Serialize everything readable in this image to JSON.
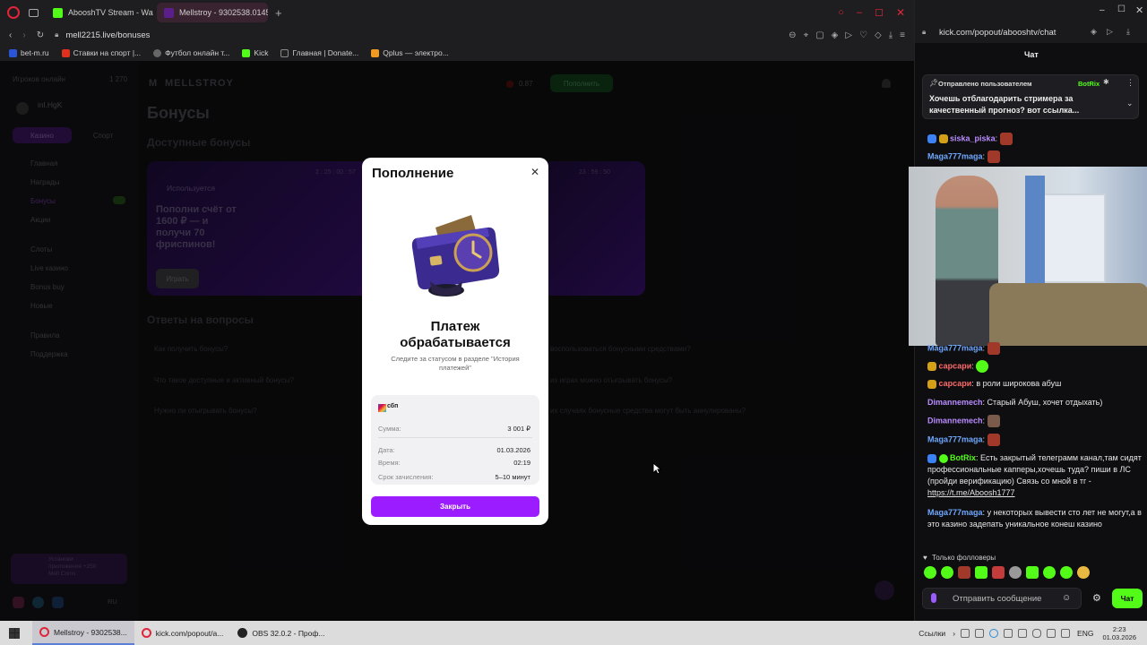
{
  "browser": {
    "tabs": [
      {
        "title": "AbooshTV Stream - Watch",
        "color": "#53fc18"
      },
      {
        "title": "Mellstroy - 9302538.0145",
        "color": "#ff2bbd"
      }
    ],
    "url": "mell2215.live/bonuses",
    "bookmarks": [
      "bet-m.ru",
      "Ставки на спорт |...",
      "Футбол онлайн т...",
      "Kick",
      "Главная | Donate...",
      "Qplus — электро..."
    ]
  },
  "site": {
    "logo": "MELLSTROY",
    "balance": "0.87",
    "deposit_button": "Пополнить",
    "user_online": "Игроков онлайн",
    "online_count": "1 270",
    "username": "inl.HgK",
    "page_title": "Бонусы",
    "available_title": "Доступные бонусы",
    "bonus_status": "Используется",
    "bonus_text": "Пополни счёт от 1600 ₽ — и получи 70 фриспинов!",
    "play_button": "Играть",
    "tabs": [
      "Казино",
      "Спорт"
    ],
    "nav": [
      "Главная",
      "Награды",
      "Бонусы",
      "Акции",
      "Слоты",
      "Live казино",
      "Bonus buy",
      "Новые",
      "Правила",
      "Поддержка"
    ],
    "faq_title": "Ответы на вопросы",
    "faq": [
      "Как получить бонусы?",
      "Что такое доступные и активный бонусы?",
      "Нужно ли отыгрывать бонусы?",
      "воспользоваться бонусными средствами?",
      "их играх можно отыгрывать бонусы?",
      "их случаях бонусные средства могут быть аннулированы?"
    ],
    "timer1": "2 : 25 : 00 : 57",
    "timer2": "23 : 59 : 50",
    "app_promo": "Установи приложение +250 Mell Coins",
    "lang": "RU"
  },
  "modal": {
    "title": "Пополнение",
    "status_title": "Платеж обрабатывается",
    "status_sub": "Следите за статусом в разделе \"История платежей\"",
    "provider": "сбп",
    "rows": [
      {
        "label": "Сумма:",
        "value": "3 001 ₽"
      },
      {
        "label": "Дата:",
        "value": "01.03.2026"
      },
      {
        "label": "Время:",
        "value": "02:19"
      },
      {
        "label": "Срок зачисления:",
        "value": "5–10 минут"
      }
    ],
    "close_button": "Закрыть"
  },
  "chat": {
    "url": "kick.com/popout/abooshtv/chat",
    "header": "Чат",
    "pinned_by": "Отправлено пользователем",
    "pinned_user": "BotRix",
    "pinned_text": "Хочешь отблагодарить стримера за качественный прогноз? вот ссылка...",
    "messages": [
      {
        "user": "siska_piska",
        "text": "",
        "color": "#b98cff"
      },
      {
        "user": "Maga777maga",
        "text": "",
        "color": "#6fa8ff"
      },
      {
        "user": "Maga777maga",
        "text": "",
        "color": "#6fa8ff"
      },
      {
        "user": "сарсари",
        "text": "",
        "color": "#ff6b6b"
      },
      {
        "user": "сарсари",
        "text": "в роли широкова абуш",
        "color": "#ff6b6b"
      },
      {
        "user": "Dimannemech",
        "text": "Старый Абуш, хочет отдыхать)",
        "color": "#b98cff"
      },
      {
        "user": "Dimannemech",
        "text": "",
        "color": "#b98cff"
      },
      {
        "user": "Maga777maga",
        "text": "",
        "color": "#6fa8ff"
      },
      {
        "user": "BotRix",
        "text": "Есть закрытый телеграмм канал,там сидят профессиональные капперы,хочешь туда? пиши в ЛС (пройди верификацию) Связь со мной в тг -",
        "color": "#53fc18",
        "link": "https://t.me/Aboosh1777"
      },
      {
        "user": "Maga777maga",
        "text": "у некоторых вывести сто лет не могут,а в это казино задепать уникальное конеш казино",
        "color": "#6fa8ff"
      }
    ],
    "followers_only": "Только фолловеры",
    "input_placeholder": "Отправить сообщение",
    "send_button": "Чат"
  },
  "taskbar": {
    "items": [
      "Mellstroy - 9302538...",
      "kick.com/popout/a...",
      "OBS 32.0.2 - Проф..."
    ],
    "links": "Ссылки",
    "lang": "ENG",
    "time": "2:23",
    "date": "01.03.2026"
  },
  "colors": {
    "accent": "#9b1cff",
    "kick_green": "#53fc18",
    "deposit_green": "#1f9d3a"
  }
}
